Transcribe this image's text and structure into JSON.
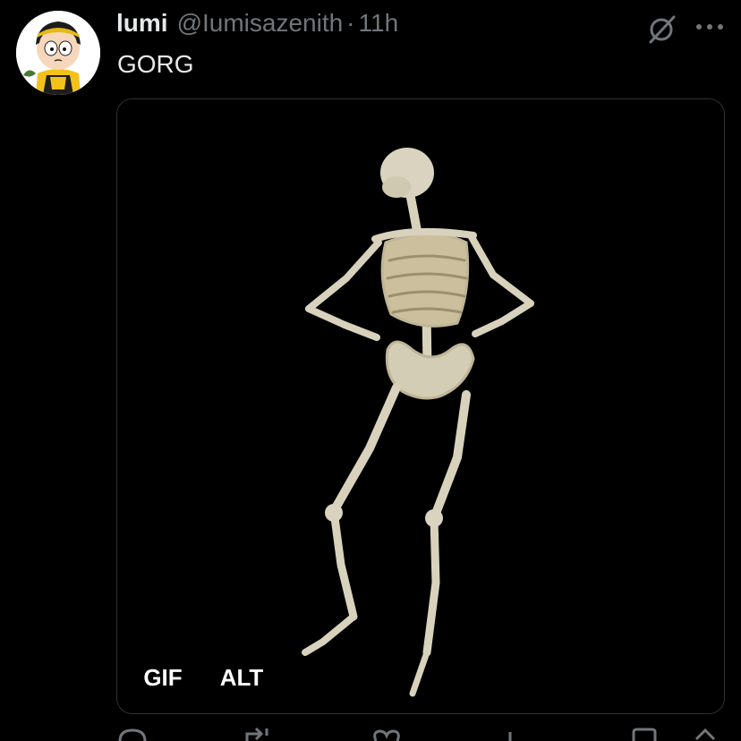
{
  "tweet": {
    "display_name": "lumi",
    "handle": "@Iumisazenith",
    "separator": "·",
    "time": "11h",
    "text": "GORG"
  },
  "media": {
    "type_badge": "GIF",
    "alt_badge": "ALT",
    "image_subject": "dancing skeleton"
  },
  "icons": {
    "grok": "grok-icon",
    "more": "more-icon",
    "reply": "reply-icon",
    "retweet": "retweet-icon",
    "like": "like-icon",
    "views": "views-icon",
    "bookmark": "bookmark-icon",
    "share": "share-icon"
  },
  "colors": {
    "background": "#000000",
    "text_primary": "#e7e9ea",
    "text_secondary": "#71767b",
    "border": "#2f3336"
  }
}
